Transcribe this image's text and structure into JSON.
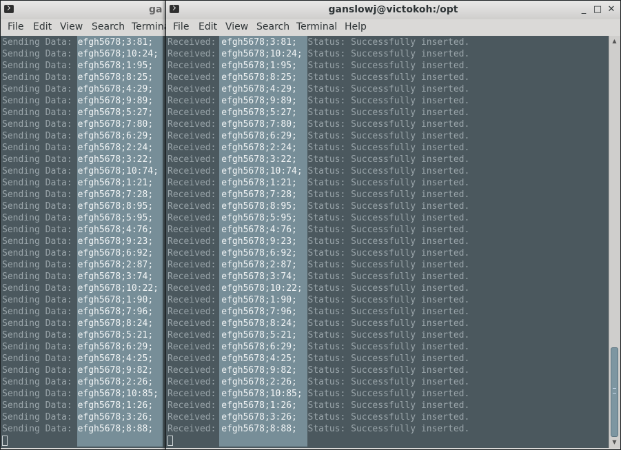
{
  "back_window": {
    "title": "ga",
    "menu": [
      "File",
      "Edit",
      "View",
      "Search",
      "Termina"
    ],
    "prefix": "Sending Data: ",
    "rows": [
      "efgh5678;3:81;",
      "efgh5678;10:24;",
      "efgh5678;1:95;",
      "efgh5678;8:25;",
      "efgh5678;4:29;",
      "efgh5678;9:89;",
      "efgh5678;5:27;",
      "efgh5678;7:80;",
      "efgh5678;6:29;",
      "efgh5678;2:24;",
      "efgh5678;3:22;",
      "efgh5678;10:74;",
      "efgh5678;1:21;",
      "efgh5678;7:28;",
      "efgh5678;8:95;",
      "efgh5678;5:95;",
      "efgh5678;4:76;",
      "efgh5678;9:23;",
      "efgh5678;6:92;",
      "efgh5678;2:87;",
      "efgh5678;3:74;",
      "efgh5678;10:22;",
      "efgh5678;1:90;",
      "efgh5678;7:96;",
      "efgh5678;8:24;",
      "efgh5678;5:21;",
      "efgh5678;6:29;",
      "efgh5678;4:25;",
      "efgh5678;9:82;",
      "efgh5678;2:26;",
      "efgh5678;10:85;",
      "efgh5678;1:26;",
      "efgh5678;3:26;",
      "efgh5678;8:88;"
    ]
  },
  "front_window": {
    "title": "ganslowj@victokoh:/opt",
    "menu": [
      "File",
      "Edit",
      "View",
      "Search",
      "Terminal",
      "Help"
    ],
    "controls": {
      "minimize": "_",
      "maximize": "□",
      "close": "✕"
    },
    "prefix": "Received: ",
    "status": "Status: Successfully inserted.",
    "rows": [
      "efgh5678;3:81;",
      "efgh5678;10:24;",
      "efgh5678;1:95;",
      "efgh5678;8:25;",
      "efgh5678;4:29;",
      "efgh5678;9:89;",
      "efgh5678;5:27;",
      "efgh5678;7:80;",
      "efgh5678;6:29;",
      "efgh5678;2:24;",
      "efgh5678;3:22;",
      "efgh5678;10:74;",
      "efgh5678;1:21;",
      "efgh5678;7:28;",
      "efgh5678;8:95;",
      "efgh5678;5:95;",
      "efgh5678;4:76;",
      "efgh5678;9:23;",
      "efgh5678;6:92;",
      "efgh5678;2:87;",
      "efgh5678;3:74;",
      "efgh5678;10:22;",
      "efgh5678;1:90;",
      "efgh5678;7:96;",
      "efgh5678;8:24;",
      "efgh5678;5:21;",
      "efgh5678;6:29;",
      "efgh5678;4:25;",
      "efgh5678;9:82;",
      "efgh5678;2:26;",
      "efgh5678;10:85;",
      "efgh5678;1:26;",
      "efgh5678;3:26;",
      "efgh5678;8:88;"
    ]
  },
  "colors": {
    "terminal_bg": "#4b585e",
    "terminal_text": "#9aa5aa",
    "selection_bg": "#778e98",
    "selection_text": "#f2f5f6"
  },
  "icons": [
    "terminal-icon",
    "minimize-icon",
    "maximize-icon",
    "close-icon",
    "scroll-up-icon",
    "scroll-down-icon"
  ]
}
